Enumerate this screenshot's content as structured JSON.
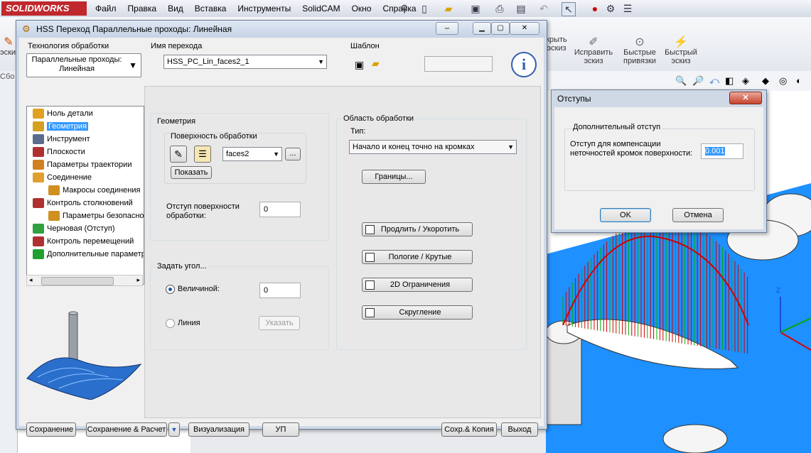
{
  "app": {
    "logo": "SOLIDWORKS",
    "menu": [
      "Файл",
      "Правка",
      "Вид",
      "Вставка",
      "Инструменты",
      "SolidCAM",
      "Окно",
      "Справка"
    ],
    "ribbon": {
      "partial_left": "эскиз",
      "partial_hide": "крыть\nэскиз",
      "fix_sketch": "Исправить\nэскиз",
      "quick_snaps": "Быстрые\nпривязки",
      "quick_sketch": "Быстрый\nэскиз",
      "sidebar_tab": "Сбо"
    }
  },
  "dialog": {
    "title": "HSS Переход Параллельные проходы: Линейная",
    "tech_label": "Технология обработки",
    "tech_value": "Параллельные проходы: Линейная",
    "op_name_label": "Имя перехода",
    "op_name_value": "HSS_PC_Lin_faces2_1",
    "template_label": "Шаблон",
    "tree": [
      {
        "label": "Ноль детали",
        "indent": 0,
        "color": "#e0a020"
      },
      {
        "label": "Геометрия",
        "indent": 0,
        "color": "#d4a020",
        "selected": true
      },
      {
        "label": "Инструмент",
        "indent": 0,
        "color": "#5a6b8c"
      },
      {
        "label": "Плоскости",
        "indent": 0,
        "color": "#b03030"
      },
      {
        "label": "Параметры траектории",
        "indent": 0,
        "color": "#d08020"
      },
      {
        "label": "Соединение",
        "indent": 0,
        "color": "#e0a030"
      },
      {
        "label": "Макросы соединения",
        "indent": 1,
        "color": "#d09020"
      },
      {
        "label": "Контроль столкновений",
        "indent": 0,
        "color": "#b03030"
      },
      {
        "label": "Параметры безопасности",
        "indent": 1,
        "color": "#d09020"
      },
      {
        "label": "Черновая (Отступ)",
        "indent": 0,
        "color": "#30a040"
      },
      {
        "label": "Контроль перемещений",
        "indent": 0,
        "color": "#b03030"
      },
      {
        "label": "Дополнительные параметры",
        "indent": 0,
        "color": "#20a030"
      }
    ],
    "geometry": {
      "group_label": "Геометрия",
      "surface_label": "Поверхность обработки",
      "faces_value": "faces2",
      "ellipsis": "...",
      "show_button": "Показать"
    },
    "offset": {
      "label": "Отступ поверхности обработки:",
      "value": "0"
    },
    "angle": {
      "group_label": "Задать угол...",
      "by_value_label": "Величиной:",
      "by_value_value": "0",
      "line_label": "Линия",
      "specify_button": "Указать"
    },
    "area": {
      "group_label": "Область обработки",
      "type_label": "Тип:",
      "type_value": "Начало и конец точно на кромках",
      "bounds_button": "Границы...",
      "toggles": [
        "Продлить / Укоротить",
        "Пологие / Крутые",
        "2D Ограничения",
        "Скругление"
      ]
    },
    "footer": {
      "save": "Сохранение",
      "save_calc": "Сохранение & Расчет",
      "visualize": "Визуализация",
      "gcode": "УП",
      "save_copy": "Сохр.& Копия",
      "exit": "Выход"
    }
  },
  "otstupy": {
    "title": "Отступы",
    "group_label": "Дополнительный отступ",
    "field_label": "Отступ для компенсации неточностей кромок поверхности:",
    "field_value": "0.001",
    "ok": "OK",
    "cancel": "Отмена"
  },
  "colors": {
    "selection": "#3399ff",
    "viewport_blue": "#1e90ff",
    "toolpath_red": "#d00000",
    "toolpath_green": "#00b000"
  }
}
